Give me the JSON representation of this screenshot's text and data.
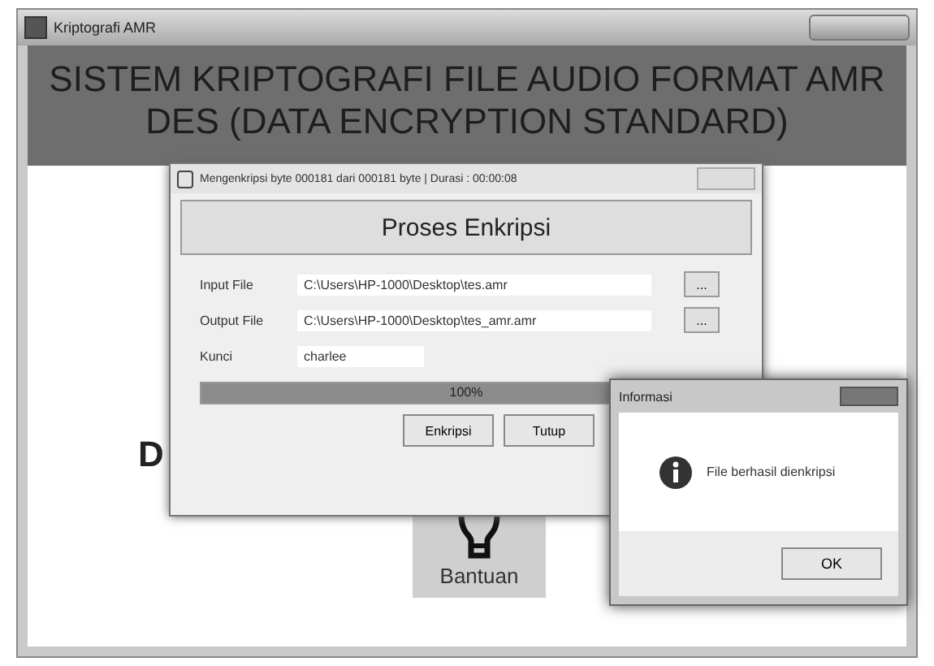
{
  "window": {
    "title": "Kriptografi AMR"
  },
  "header": {
    "title": "SISTEM KRIPTOGRAFI FILE AUDIO FORMAT AMR DES (DATA ENCRYPTION STANDARD)"
  },
  "background": {
    "partial_label": "D",
    "help_button": "Bantuan"
  },
  "progress_dialog": {
    "title": "Mengenkripsi byte 000181 dari 000181 byte | Durasi : 00:00:08",
    "heading": "Proses Enkripsi",
    "fields": [
      {
        "label": "Input File",
        "value": "C:\\Users\\HP-1000\\Desktop\\tes.amr",
        "browse": "..."
      },
      {
        "label": "Output File",
        "value": "C:\\Users\\HP-1000\\Desktop\\tes_amr.amr",
        "browse": "..."
      },
      {
        "label": "Kunci",
        "value": "charlee"
      }
    ],
    "progress": {
      "level": 1,
      "reading": "100%"
    },
    "buttons": [
      "Enkripsi",
      "Tutup"
    ]
  },
  "message_box": {
    "title": "Informasi",
    "message": "File berhasil dienkripsi",
    "button": "OK"
  }
}
